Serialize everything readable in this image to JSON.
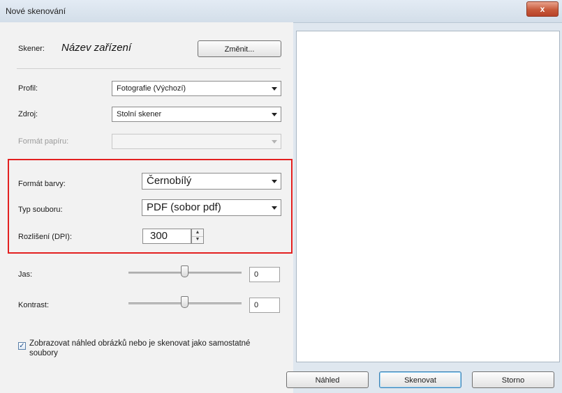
{
  "window": {
    "title": "Nové skenování",
    "close_label": "x"
  },
  "scanner": {
    "label": "Skener:",
    "device_name": "Název zařízení",
    "change_button": "Změnit..."
  },
  "profile": {
    "label": "Profil:",
    "value": "Fotografie (Výchozí)"
  },
  "source": {
    "label": "Zdroj:",
    "value": "Stolní skener"
  },
  "paper_format": {
    "label": "Formát papíru:",
    "value": ""
  },
  "color_format": {
    "label": "Formát barvy:",
    "value": "Černobílý"
  },
  "file_type": {
    "label": "Typ souboru:",
    "value": "PDF (sobor pdf)"
  },
  "resolution": {
    "label": "Rozlišení (DPI):",
    "value": "300"
  },
  "brightness": {
    "label": "Jas:",
    "value": "0"
  },
  "contrast": {
    "label": "Kontrast:",
    "value": "0"
  },
  "separate_files": {
    "label": "Zobrazovat náhled obrázků nebo je skenovat jako samostatné soubory",
    "checked": true
  },
  "buttons": {
    "preview": "Náhled",
    "scan": "Skenovat",
    "cancel": "Storno"
  },
  "colors": {
    "highlight": "#e32020",
    "title_bar": "#d9e3ee",
    "close_button": "#c75a3b"
  }
}
